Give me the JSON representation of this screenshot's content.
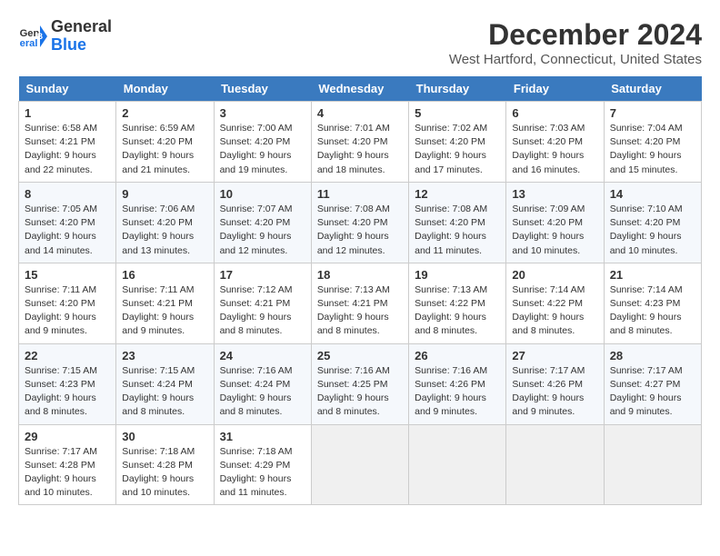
{
  "logo": {
    "line1": "General",
    "line2": "Blue"
  },
  "title": "December 2024",
  "location": "West Hartford, Connecticut, United States",
  "days_of_week": [
    "Sunday",
    "Monday",
    "Tuesday",
    "Wednesday",
    "Thursday",
    "Friday",
    "Saturday"
  ],
  "weeks": [
    [
      {
        "day": "1",
        "sunrise": "6:58 AM",
        "sunset": "4:21 PM",
        "daylight": "9 hours and 22 minutes."
      },
      {
        "day": "2",
        "sunrise": "6:59 AM",
        "sunset": "4:20 PM",
        "daylight": "9 hours and 21 minutes."
      },
      {
        "day": "3",
        "sunrise": "7:00 AM",
        "sunset": "4:20 PM",
        "daylight": "9 hours and 19 minutes."
      },
      {
        "day": "4",
        "sunrise": "7:01 AM",
        "sunset": "4:20 PM",
        "daylight": "9 hours and 18 minutes."
      },
      {
        "day": "5",
        "sunrise": "7:02 AM",
        "sunset": "4:20 PM",
        "daylight": "9 hours and 17 minutes."
      },
      {
        "day": "6",
        "sunrise": "7:03 AM",
        "sunset": "4:20 PM",
        "daylight": "9 hours and 16 minutes."
      },
      {
        "day": "7",
        "sunrise": "7:04 AM",
        "sunset": "4:20 PM",
        "daylight": "9 hours and 15 minutes."
      }
    ],
    [
      {
        "day": "8",
        "sunrise": "7:05 AM",
        "sunset": "4:20 PM",
        "daylight": "9 hours and 14 minutes."
      },
      {
        "day": "9",
        "sunrise": "7:06 AM",
        "sunset": "4:20 PM",
        "daylight": "9 hours and 13 minutes."
      },
      {
        "day": "10",
        "sunrise": "7:07 AM",
        "sunset": "4:20 PM",
        "daylight": "9 hours and 12 minutes."
      },
      {
        "day": "11",
        "sunrise": "7:08 AM",
        "sunset": "4:20 PM",
        "daylight": "9 hours and 12 minutes."
      },
      {
        "day": "12",
        "sunrise": "7:08 AM",
        "sunset": "4:20 PM",
        "daylight": "9 hours and 11 minutes."
      },
      {
        "day": "13",
        "sunrise": "7:09 AM",
        "sunset": "4:20 PM",
        "daylight": "9 hours and 10 minutes."
      },
      {
        "day": "14",
        "sunrise": "7:10 AM",
        "sunset": "4:20 PM",
        "daylight": "9 hours and 10 minutes."
      }
    ],
    [
      {
        "day": "15",
        "sunrise": "7:11 AM",
        "sunset": "4:20 PM",
        "daylight": "9 hours and 9 minutes."
      },
      {
        "day": "16",
        "sunrise": "7:11 AM",
        "sunset": "4:21 PM",
        "daylight": "9 hours and 9 minutes."
      },
      {
        "day": "17",
        "sunrise": "7:12 AM",
        "sunset": "4:21 PM",
        "daylight": "9 hours and 8 minutes."
      },
      {
        "day": "18",
        "sunrise": "7:13 AM",
        "sunset": "4:21 PM",
        "daylight": "9 hours and 8 minutes."
      },
      {
        "day": "19",
        "sunrise": "7:13 AM",
        "sunset": "4:22 PM",
        "daylight": "9 hours and 8 minutes."
      },
      {
        "day": "20",
        "sunrise": "7:14 AM",
        "sunset": "4:22 PM",
        "daylight": "9 hours and 8 minutes."
      },
      {
        "day": "21",
        "sunrise": "7:14 AM",
        "sunset": "4:23 PM",
        "daylight": "9 hours and 8 minutes."
      }
    ],
    [
      {
        "day": "22",
        "sunrise": "7:15 AM",
        "sunset": "4:23 PM",
        "daylight": "9 hours and 8 minutes."
      },
      {
        "day": "23",
        "sunrise": "7:15 AM",
        "sunset": "4:24 PM",
        "daylight": "9 hours and 8 minutes."
      },
      {
        "day": "24",
        "sunrise": "7:16 AM",
        "sunset": "4:24 PM",
        "daylight": "9 hours and 8 minutes."
      },
      {
        "day": "25",
        "sunrise": "7:16 AM",
        "sunset": "4:25 PM",
        "daylight": "9 hours and 8 minutes."
      },
      {
        "day": "26",
        "sunrise": "7:16 AM",
        "sunset": "4:26 PM",
        "daylight": "9 hours and 9 minutes."
      },
      {
        "day": "27",
        "sunrise": "7:17 AM",
        "sunset": "4:26 PM",
        "daylight": "9 hours and 9 minutes."
      },
      {
        "day": "28",
        "sunrise": "7:17 AM",
        "sunset": "4:27 PM",
        "daylight": "9 hours and 9 minutes."
      }
    ],
    [
      {
        "day": "29",
        "sunrise": "7:17 AM",
        "sunset": "4:28 PM",
        "daylight": "9 hours and 10 minutes."
      },
      {
        "day": "30",
        "sunrise": "7:18 AM",
        "sunset": "4:28 PM",
        "daylight": "9 hours and 10 minutes."
      },
      {
        "day": "31",
        "sunrise": "7:18 AM",
        "sunset": "4:29 PM",
        "daylight": "9 hours and 11 minutes."
      },
      null,
      null,
      null,
      null
    ]
  ]
}
